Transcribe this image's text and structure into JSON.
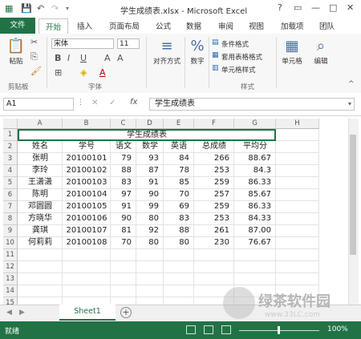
{
  "window": {
    "title": "学生成绩表.xlsx - Microsoft Excel",
    "controls": [
      "?",
      "▭",
      "—",
      "□",
      "✕"
    ]
  },
  "ribbon_tabs": [
    "文件",
    "开始",
    "插入",
    "页面布局",
    "公式",
    "数据",
    "审阅",
    "视图",
    "加载项",
    "团队"
  ],
  "ribbon": {
    "paste": "粘贴",
    "font_name": "宋体",
    "font_size": "11",
    "align": "对齐方式",
    "number": "数字",
    "percent": "%",
    "cond_format": "条件格式",
    "table_format": "套用表格格式",
    "cell_style": "单元格样式",
    "cells": "单元格",
    "editing": "编辑",
    "groups": {
      "clipboard": "剪贴板",
      "font": "字体",
      "styles": "样式"
    }
  },
  "formula_bar": {
    "name_box": "A1",
    "fx": "fx",
    "content": "学生成绩表"
  },
  "grid": {
    "columns": [
      "A",
      "B",
      "C",
      "D",
      "E",
      "F",
      "G",
      "H"
    ],
    "rows": [
      "1",
      "2",
      "3",
      "4",
      "5",
      "6",
      "7",
      "8",
      "9",
      "10",
      "11",
      "12",
      "13",
      "14",
      "15",
      "16"
    ],
    "title": "学生成绩表",
    "header": [
      "姓名",
      "学号",
      "语文",
      "数学",
      "英语",
      "总成绩",
      "平均分"
    ],
    "data": [
      [
        "张明",
        "20100101",
        "79",
        "93",
        "84",
        "266",
        "88.67"
      ],
      [
        "李玲",
        "20100102",
        "88",
        "87",
        "78",
        "253",
        "84.3"
      ],
      [
        "王潇潇",
        "20100103",
        "83",
        "91",
        "85",
        "259",
        "86.33"
      ],
      [
        "陈明",
        "20100104",
        "97",
        "90",
        "70",
        "257",
        "85.67"
      ],
      [
        "邓圆圆",
        "20100105",
        "91",
        "99",
        "69",
        "259",
        "86.33"
      ],
      [
        "方晓华",
        "20100106",
        "90",
        "80",
        "83",
        "253",
        "84.33"
      ],
      [
        "龚琪",
        "20100107",
        "81",
        "92",
        "88",
        "261",
        "87.00"
      ],
      [
        "何莉莉",
        "20100108",
        "70",
        "80",
        "80",
        "230",
        "76.67"
      ]
    ]
  },
  "sheet_tab": "Sheet1",
  "status": {
    "ready": "就绪",
    "zoom": "100%"
  },
  "watermark": {
    "text": "绿茶软件园",
    "url": "www.33LC.com"
  },
  "colors": {
    "accent": "#217346"
  }
}
